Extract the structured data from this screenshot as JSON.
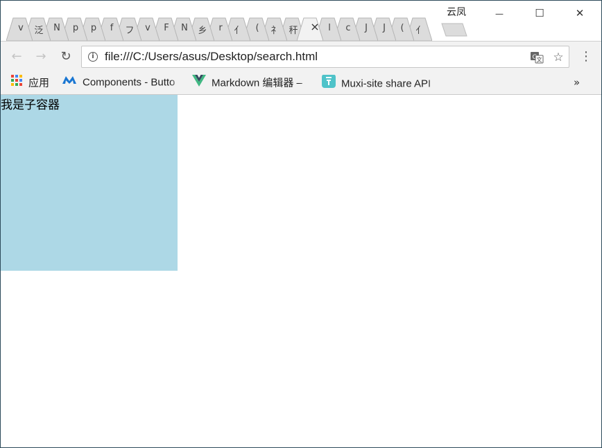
{
  "window": {
    "profile_name": "云凤",
    "controls": {
      "minimize": "—",
      "maximize": "☐",
      "close": "✕"
    }
  },
  "tabs": [
    {
      "glyph": "v"
    },
    {
      "glyph": "泛"
    },
    {
      "glyph": "N"
    },
    {
      "glyph": "p"
    },
    {
      "glyph": "p"
    },
    {
      "glyph": "f"
    },
    {
      "glyph": "フ"
    },
    {
      "glyph": "v"
    },
    {
      "glyph": "F"
    },
    {
      "glyph": "N"
    },
    {
      "glyph": "乡"
    },
    {
      "glyph": "r"
    },
    {
      "glyph": "亻"
    },
    {
      "glyph": "("
    },
    {
      "glyph": "礻"
    },
    {
      "glyph": "秆"
    },
    {
      "glyph": "×",
      "active": true
    },
    {
      "glyph": "l"
    },
    {
      "glyph": "c"
    },
    {
      "glyph": "J"
    },
    {
      "glyph": "J"
    },
    {
      "glyph": "("
    },
    {
      "glyph": "亻"
    }
  ],
  "toolbar": {
    "back": "←",
    "forward": "→",
    "reload": "↻",
    "url": "file:///C:/Users/asus/Desktop/search.html",
    "menu": "⋮"
  },
  "bookmarks": {
    "items": [
      {
        "label": "应用",
        "icon": "apps-grid-icon"
      },
      {
        "label": "Components - Butto",
        "icon": "material-logo-icon"
      },
      {
        "label": "Markdown 编辑器 –",
        "icon": "vue-logo-icon"
      },
      {
        "label": "Muxi-site share API",
        "icon": "muxi-icon"
      }
    ],
    "overflow": "»"
  },
  "page": {
    "child_text": "我是子容器",
    "box_color": "#add8e6"
  },
  "colors": {
    "toolbar_bg": "#f2f2f2",
    "tab_bg": "#dcdcdc",
    "active_tab_bg": "#f2f2f2"
  }
}
